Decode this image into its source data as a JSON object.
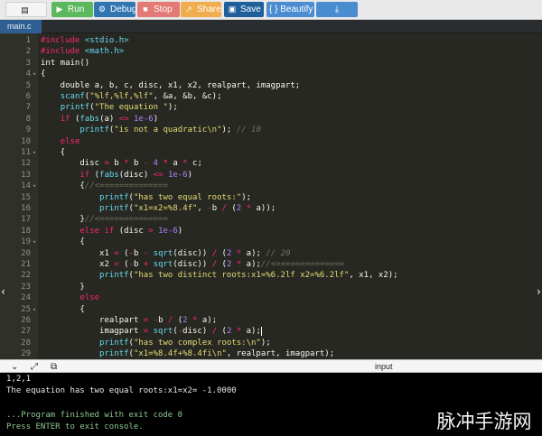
{
  "toolbar": {
    "file_label": "",
    "run_label": "Run",
    "debug_label": "Debug",
    "stop_label": "Stop",
    "share_label": "Share",
    "save_label": "Save",
    "beautify_label": "{ } Beautify",
    "download_label": ""
  },
  "tabs": [
    "main.c"
  ],
  "editor": {
    "lines": [
      {
        "n": "1",
        "fold": "",
        "tokens": [
          [
            "kw",
            "#include "
          ],
          [
            "inc",
            "<stdio.h>"
          ]
        ]
      },
      {
        "n": "2",
        "fold": "",
        "tokens": [
          [
            "kw",
            "#include "
          ],
          [
            "inc",
            "<math.h>"
          ]
        ]
      },
      {
        "n": "3",
        "fold": "",
        "tokens": [
          [
            "txt",
            "int main()"
          ]
        ]
      },
      {
        "n": "4",
        "fold": "▾",
        "tokens": [
          [
            "txt",
            "{"
          ]
        ]
      },
      {
        "n": "5",
        "fold": "",
        "tokens": [
          [
            "txt",
            "    double a, b, c, disc, x1, x2, realpart, imagpart;"
          ]
        ]
      },
      {
        "n": "6",
        "fold": "",
        "tokens": [
          [
            "txt",
            "    "
          ],
          [
            "fn",
            "scanf"
          ],
          [
            "txt",
            "("
          ],
          [
            "str",
            "\"%lf,%lf,%lf\""
          ],
          [
            "txt",
            ", &a, &b, &c);"
          ]
        ]
      },
      {
        "n": "7",
        "fold": "",
        "tokens": [
          [
            "txt",
            "    "
          ],
          [
            "fn",
            "printf"
          ],
          [
            "txt",
            "("
          ],
          [
            "str",
            "\"The equation \""
          ],
          [
            "txt",
            ");"
          ]
        ]
      },
      {
        "n": "8",
        "fold": "",
        "tokens": [
          [
            "txt",
            "    "
          ],
          [
            "kw",
            "if"
          ],
          [
            "txt",
            " ("
          ],
          [
            "fn",
            "fabs"
          ],
          [
            "txt",
            "(a) "
          ],
          [
            "op",
            "<="
          ],
          [
            "txt",
            " "
          ],
          [
            "num",
            "1e-6"
          ],
          [
            "txt",
            ")"
          ]
        ]
      },
      {
        "n": "9",
        "fold": "",
        "tokens": [
          [
            "txt",
            "        "
          ],
          [
            "fn",
            "printf"
          ],
          [
            "txt",
            "("
          ],
          [
            "str",
            "\"is not a quadratic\\n\""
          ],
          [
            "txt",
            "); "
          ],
          [
            "cm",
            "// 10"
          ]
        ]
      },
      {
        "n": "10",
        "fold": "",
        "tokens": [
          [
            "txt",
            "    "
          ],
          [
            "kw",
            "else"
          ]
        ]
      },
      {
        "n": "11",
        "fold": "▾",
        "tokens": [
          [
            "txt",
            "    {"
          ]
        ]
      },
      {
        "n": "12",
        "fold": "",
        "tokens": [
          [
            "txt",
            "        disc "
          ],
          [
            "op",
            "="
          ],
          [
            "txt",
            " b "
          ],
          [
            "op",
            "*"
          ],
          [
            "txt",
            " b "
          ],
          [
            "op",
            "-"
          ],
          [
            "txt",
            " "
          ],
          [
            "num",
            "4"
          ],
          [
            "txt",
            " "
          ],
          [
            "op",
            "*"
          ],
          [
            "txt",
            " a "
          ],
          [
            "op",
            "*"
          ],
          [
            "txt",
            " c;"
          ]
        ]
      },
      {
        "n": "13",
        "fold": "",
        "tokens": [
          [
            "txt",
            "        "
          ],
          [
            "kw",
            "if"
          ],
          [
            "txt",
            " ("
          ],
          [
            "fn",
            "fabs"
          ],
          [
            "txt",
            "(disc) "
          ],
          [
            "op",
            "<="
          ],
          [
            "txt",
            " "
          ],
          [
            "num",
            "1e-6"
          ],
          [
            "txt",
            ")"
          ]
        ]
      },
      {
        "n": "14",
        "fold": "▾",
        "tokens": [
          [
            "txt",
            "        {"
          ],
          [
            "cm",
            "//<=============="
          ]
        ]
      },
      {
        "n": "15",
        "fold": "",
        "tokens": [
          [
            "txt",
            "            "
          ],
          [
            "fn",
            "printf"
          ],
          [
            "txt",
            "("
          ],
          [
            "str",
            "\"has two equal roots:\""
          ],
          [
            "txt",
            ");"
          ]
        ]
      },
      {
        "n": "16",
        "fold": "",
        "tokens": [
          [
            "txt",
            "            "
          ],
          [
            "fn",
            "printf"
          ],
          [
            "txt",
            "("
          ],
          [
            "str",
            "\"x1=x2=%8.4f\""
          ],
          [
            "txt",
            ", "
          ],
          [
            "op",
            "-"
          ],
          [
            "txt",
            "b "
          ],
          [
            "op",
            "/"
          ],
          [
            "txt",
            " ("
          ],
          [
            "num",
            "2"
          ],
          [
            "txt",
            " "
          ],
          [
            "op",
            "*"
          ],
          [
            "txt",
            " a));"
          ]
        ]
      },
      {
        "n": "17",
        "fold": "",
        "tokens": [
          [
            "txt",
            "        }"
          ],
          [
            "cm",
            "//<=============="
          ]
        ]
      },
      {
        "n": "18",
        "fold": "",
        "tokens": [
          [
            "txt",
            "        "
          ],
          [
            "kw",
            "else if"
          ],
          [
            "txt",
            " (disc "
          ],
          [
            "op",
            ">"
          ],
          [
            "txt",
            " "
          ],
          [
            "num",
            "1e-6"
          ],
          [
            "txt",
            ")"
          ]
        ]
      },
      {
        "n": "19",
        "fold": "▾",
        "tokens": [
          [
            "txt",
            "        {"
          ]
        ]
      },
      {
        "n": "20",
        "fold": "",
        "tokens": [
          [
            "txt",
            "            x1 "
          ],
          [
            "op",
            "="
          ],
          [
            "txt",
            " ("
          ],
          [
            "op",
            "-"
          ],
          [
            "txt",
            "b "
          ],
          [
            "op",
            "-"
          ],
          [
            "txt",
            " "
          ],
          [
            "fn",
            "sqrt"
          ],
          [
            "txt",
            "(disc)) "
          ],
          [
            "op",
            "/"
          ],
          [
            "txt",
            " ("
          ],
          [
            "num",
            "2"
          ],
          [
            "txt",
            " "
          ],
          [
            "op",
            "*"
          ],
          [
            "txt",
            " a); "
          ],
          [
            "cm",
            "// 20"
          ]
        ]
      },
      {
        "n": "21",
        "fold": "",
        "tokens": [
          [
            "txt",
            "            x2 "
          ],
          [
            "op",
            "="
          ],
          [
            "txt",
            " ("
          ],
          [
            "op",
            "-"
          ],
          [
            "txt",
            "b "
          ],
          [
            "op",
            "+"
          ],
          [
            "txt",
            " "
          ],
          [
            "fn",
            "sqrt"
          ],
          [
            "txt",
            "(disc)) "
          ],
          [
            "op",
            "/"
          ],
          [
            "txt",
            " ("
          ],
          [
            "num",
            "2"
          ],
          [
            "txt",
            " "
          ],
          [
            "op",
            "*"
          ],
          [
            "txt",
            " a);"
          ],
          [
            "cm",
            "//<=============="
          ]
        ]
      },
      {
        "n": "22",
        "fold": "",
        "tokens": [
          [
            "txt",
            "            "
          ],
          [
            "fn",
            "printf"
          ],
          [
            "txt",
            "("
          ],
          [
            "str",
            "\"has two distinct roots:x1=%6.2lf x2=%6.2lf\""
          ],
          [
            "txt",
            ", x1, x2);"
          ]
        ]
      },
      {
        "n": "23",
        "fold": "",
        "tokens": [
          [
            "txt",
            "        }"
          ]
        ]
      },
      {
        "n": "24",
        "fold": "",
        "tokens": [
          [
            "txt",
            "        "
          ],
          [
            "kw",
            "else"
          ]
        ]
      },
      {
        "n": "25",
        "fold": "▾",
        "tokens": [
          [
            "txt",
            "        {"
          ]
        ]
      },
      {
        "n": "26",
        "fold": "",
        "tokens": [
          [
            "txt",
            "            realpart "
          ],
          [
            "op",
            "="
          ],
          [
            "txt",
            " "
          ],
          [
            "op",
            "-"
          ],
          [
            "txt",
            "b "
          ],
          [
            "op",
            "/"
          ],
          [
            "txt",
            " ("
          ],
          [
            "num",
            "2"
          ],
          [
            "txt",
            " "
          ],
          [
            "op",
            "*"
          ],
          [
            "txt",
            " a);"
          ]
        ]
      },
      {
        "n": "27",
        "fold": "",
        "tokens": [
          [
            "txt",
            "            imagpart "
          ],
          [
            "op",
            "="
          ],
          [
            "txt",
            " "
          ],
          [
            "fn",
            "sqrt"
          ],
          [
            "txt",
            "("
          ],
          [
            "op",
            "-"
          ],
          [
            "txt",
            "disc) "
          ],
          [
            "op",
            "/"
          ],
          [
            "txt",
            " ("
          ],
          [
            "num",
            "2"
          ],
          [
            "txt",
            " "
          ],
          [
            "op",
            "*"
          ],
          [
            "txt",
            " a);"
          ],
          [
            "cursor",
            ""
          ]
        ]
      },
      {
        "n": "28",
        "fold": "",
        "tokens": [
          [
            "txt",
            "            "
          ],
          [
            "fn",
            "printf"
          ],
          [
            "txt",
            "("
          ],
          [
            "str",
            "\"has two complex roots:\\n\""
          ],
          [
            "txt",
            ");"
          ]
        ]
      },
      {
        "n": "29",
        "fold": "",
        "tokens": [
          [
            "txt",
            "            "
          ],
          [
            "fn",
            "printf"
          ],
          [
            "txt",
            "("
          ],
          [
            "str",
            "\"x1=%8.4f+%8.4fi\\n\""
          ],
          [
            "txt",
            ", realpart, imagpart);"
          ]
        ]
      }
    ]
  },
  "io": {
    "label": "input"
  },
  "console": {
    "input_echo": "1,2,1",
    "output": "The equation has two equal roots:x1=x2= -1.0000",
    "finished": "...Program finished with exit code 0",
    "prompt": "Press ENTER to exit console."
  },
  "watermark": "脉冲手游网"
}
